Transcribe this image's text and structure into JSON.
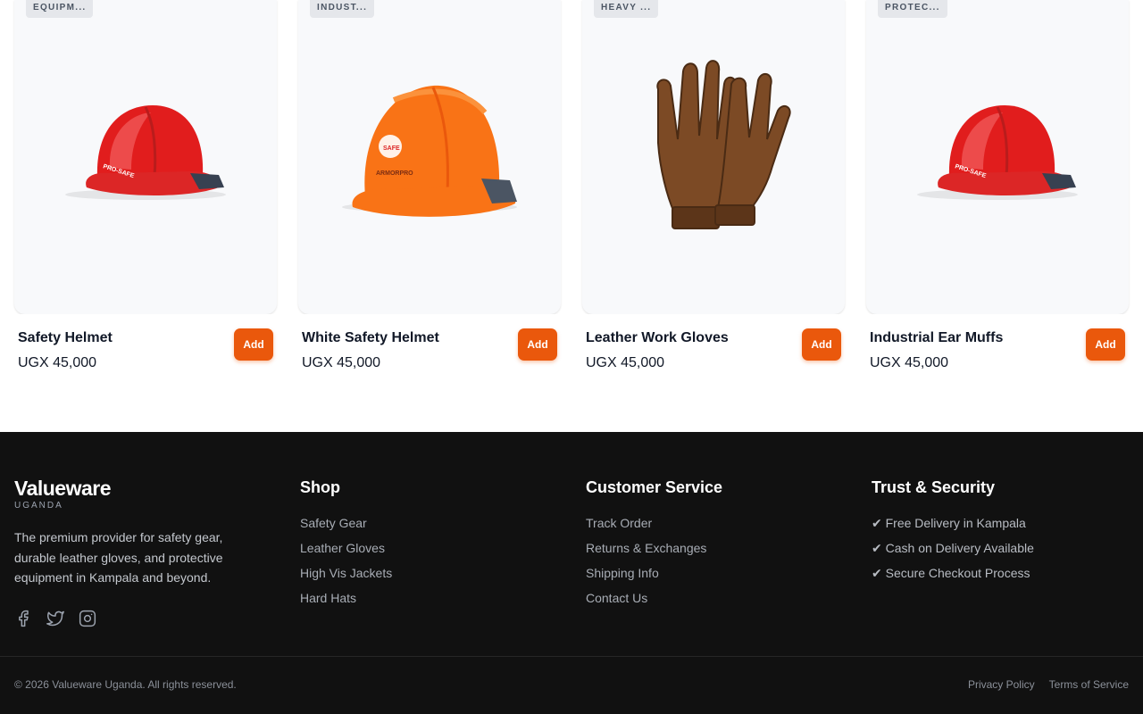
{
  "products": [
    {
      "category": "EQUIPM...",
      "name": "Safety Helmet",
      "price": "UGX 45,000",
      "add_label": "Add",
      "image": "red-safety-helmet"
    },
    {
      "category": "INDUST...",
      "name": "White Safety Helmet",
      "price": "UGX 45,000",
      "add_label": "Add",
      "image": "orange-safety-helmet"
    },
    {
      "category": "HEAVY ...",
      "name": "Leather Work Gloves",
      "price": "UGX 45,000",
      "add_label": "Add",
      "image": "leather-work-gloves"
    },
    {
      "category": "PROTEC...",
      "name": "Industrial Ear Muffs",
      "price": "UGX 45,000",
      "add_label": "Add",
      "image": "red-safety-helmet"
    }
  ],
  "footer": {
    "brand": {
      "name": "Valueware",
      "sub": "UGANDA",
      "description": "The premium provider for safety gear, durable leather gloves, and protective equipment in Kampala and beyond.",
      "socials": [
        "facebook-icon",
        "twitter-icon",
        "instagram-icon"
      ]
    },
    "shop": {
      "title": "Shop",
      "links": [
        "Safety Gear",
        "Leather Gloves",
        "High Vis Jackets",
        "Hard Hats"
      ]
    },
    "customer_service": {
      "title": "Customer Service",
      "links": [
        "Track Order",
        "Returns & Exchanges",
        "Shipping Info",
        "Contact Us"
      ]
    },
    "trust": {
      "title": "Trust & Security",
      "items": [
        "✔ Free Delivery in Kampala",
        "✔ Cash on Delivery Available",
        "✔ Secure Checkout Process"
      ]
    },
    "copyright": "© 2026 Valueware Uganda. All rights reserved.",
    "legal": [
      "Privacy Policy",
      "Terms of Service"
    ]
  },
  "colors": {
    "accent": "#ea580c",
    "footer_bg": "#111111",
    "card_bg": "#f8f9fb"
  }
}
